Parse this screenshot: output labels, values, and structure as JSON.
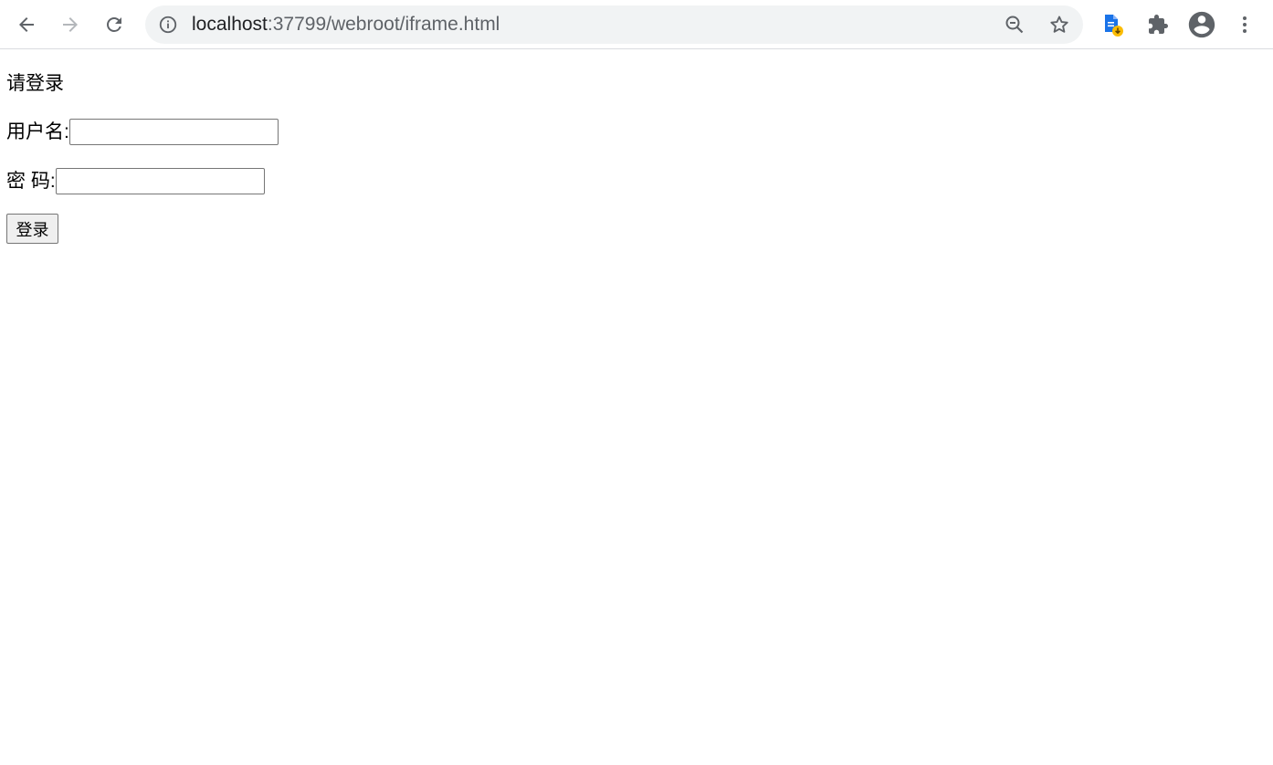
{
  "browser": {
    "url_host": "localhost",
    "url_path": ":37799/webroot/iframe.html",
    "icons": {
      "back": "arrow-left-icon",
      "forward": "arrow-right-icon",
      "reload": "reload-icon",
      "site_info": "info-icon",
      "zoom": "zoom-out-icon",
      "bookmark": "star-icon",
      "extension_doc": "document-download-icon",
      "extensions": "puzzle-icon",
      "profile": "account-circle-icon",
      "menu": "kebab-menu-icon"
    }
  },
  "page": {
    "title": "请登录",
    "username_label": "用户名:",
    "username_value": "",
    "password_label": "密 码:",
    "password_value": "",
    "login_button": "登录"
  },
  "colors": {
    "chrome_icon": "#5f6368",
    "omnibox_bg": "#f1f3f4",
    "extension_blue": "#1a73e8",
    "extension_badge": "#fbbc04"
  }
}
